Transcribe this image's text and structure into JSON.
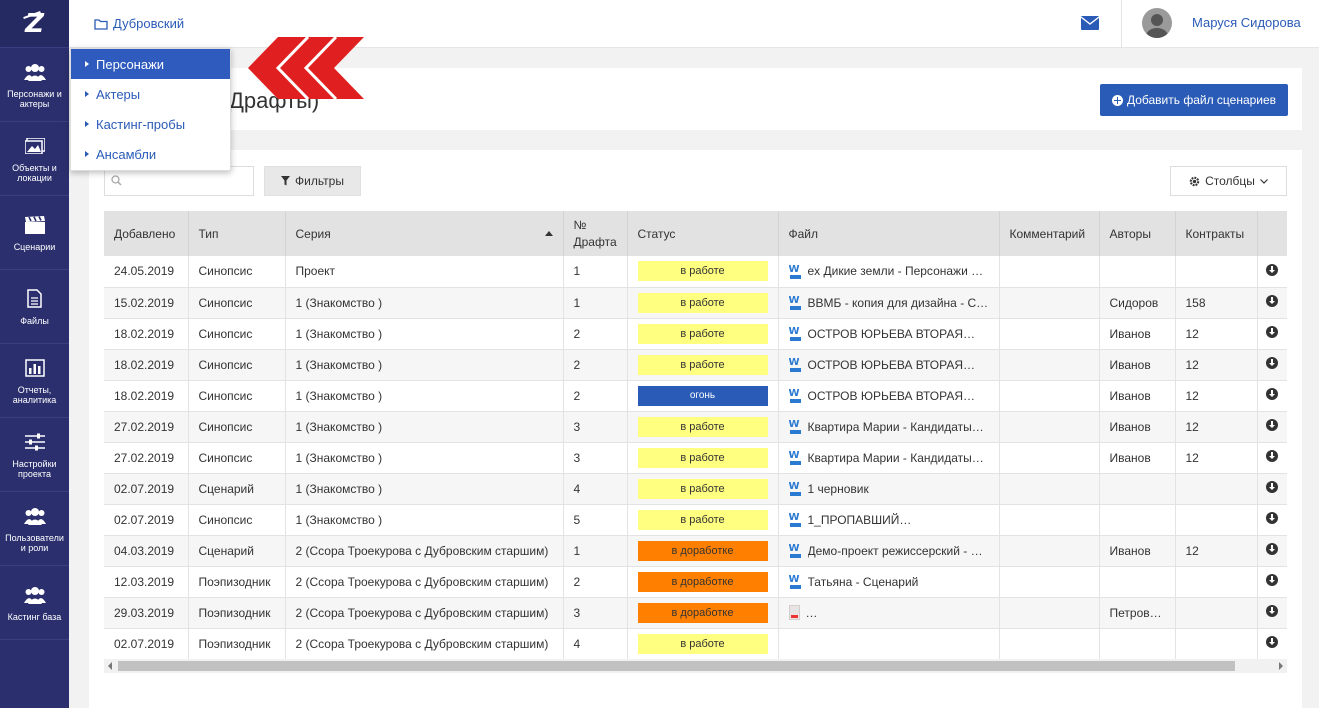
{
  "sidebar": {
    "items": [
      {
        "label": "Персонажи и актеры",
        "icon": "users-icon"
      },
      {
        "label": "Объекты и локации",
        "icon": "image-icon"
      },
      {
        "label": "Сценарии",
        "icon": "clapperboard-icon"
      },
      {
        "label": "Файлы",
        "icon": "file-icon"
      },
      {
        "label": "Отчеты, аналитика",
        "icon": "bar-chart-icon"
      },
      {
        "label": "Настройки проекта",
        "icon": "sliders-icon"
      },
      {
        "label": "Пользователи и роли",
        "icon": "users-icon"
      },
      {
        "label": "Кастинг база",
        "icon": "users-icon"
      }
    ]
  },
  "topbar": {
    "project": "Дубровский",
    "username": "Маруся Сидорова"
  },
  "dropdown": {
    "items": [
      "Персонажи",
      "Актеры",
      "Кастинг-пробы",
      "Ансамбли"
    ]
  },
  "page": {
    "title_visible": "Драфты)",
    "add_button": "Добавить файл сценариев"
  },
  "toolbar": {
    "search_placeholder": "",
    "filters_label": "Фильтры",
    "columns_label": "Столбцы"
  },
  "table": {
    "headers": [
      "Добавлено",
      "Тип",
      "Серия",
      "№ Драфта",
      "Статус",
      "Файл",
      "Комментарий",
      "Авторы",
      "Контракты",
      ""
    ],
    "rows": [
      {
        "date": "24.05.2019",
        "type": "Синопсис",
        "series": "Проект",
        "draft": "1",
        "status": "в работе",
        "status_color": "yellow",
        "file": "ex Дикие земли - Персонажи с…",
        "file_icon": "word",
        "comment": "",
        "authors": "",
        "contracts": ""
      },
      {
        "date": "15.02.2019",
        "type": "Синопсис",
        "series": "1 (Знакомство )",
        "draft": "1",
        "status": "в работе",
        "status_color": "yellow",
        "file": "ВВМБ - копия для дизайна - С…",
        "file_icon": "word",
        "comment": "",
        "authors": "Сидоров",
        "contracts": "158"
      },
      {
        "date": "18.02.2019",
        "type": "Синопсис",
        "series": "1 (Знакомство )",
        "draft": "2",
        "status": "в работе",
        "status_color": "yellow",
        "file": "ОСТРОВ ЮРЬЕВА ВТОРАЯ…",
        "file_icon": "word",
        "comment": "",
        "authors": "Иванов",
        "contracts": "12"
      },
      {
        "date": "18.02.2019",
        "type": "Синопсис",
        "series": "1 (Знакомство )",
        "draft": "2",
        "status": "в работе",
        "status_color": "yellow",
        "file": "ОСТРОВ ЮРЬЕВА ВТОРАЯ…",
        "file_icon": "word",
        "comment": "",
        "authors": "Иванов",
        "contracts": "12"
      },
      {
        "date": "18.02.2019",
        "type": "Синопсис",
        "series": "1 (Знакомство )",
        "draft": "2",
        "status": "огонь",
        "status_color": "blue",
        "file": "ОСТРОВ ЮРЬЕВА ВТОРАЯ…",
        "file_icon": "word",
        "comment": "",
        "authors": "Иванов",
        "contracts": "12"
      },
      {
        "date": "27.02.2019",
        "type": "Синопсис",
        "series": "1 (Знакомство )",
        "draft": "3",
        "status": "в работе",
        "status_color": "yellow",
        "file": "Квартира Марии - Кандидаты…",
        "file_icon": "word",
        "comment": "",
        "authors": "Иванов",
        "contracts": "12"
      },
      {
        "date": "27.02.2019",
        "type": "Синопсис",
        "series": "1 (Знакомство )",
        "draft": "3",
        "status": "в работе",
        "status_color": "yellow",
        "file": "Квартира Марии - Кандидаты…",
        "file_icon": "word",
        "comment": "",
        "authors": "Иванов",
        "contracts": "12"
      },
      {
        "date": "02.07.2019",
        "type": "Сценарий",
        "series": "1 (Знакомство )",
        "draft": "4",
        "status": "в работе",
        "status_color": "yellow",
        "file": "1 черновик",
        "file_icon": "word",
        "comment": "",
        "authors": "",
        "contracts": ""
      },
      {
        "date": "02.07.2019",
        "type": "Синопсис",
        "series": "1 (Знакомство )",
        "draft": "5",
        "status": "в работе",
        "status_color": "yellow",
        "file": "1_ПРОПАВШИЙ…",
        "file_icon": "word",
        "comment": "",
        "authors": "",
        "contracts": ""
      },
      {
        "date": "04.03.2019",
        "type": "Сценарий",
        "series": "2 (Ссора Троекурова с Дубровским старшим)",
        "draft": "1",
        "status": "в доработке",
        "status_color": "orange",
        "file": "Демо-проект режиссерский - …",
        "file_icon": "word",
        "comment": "",
        "authors": "Иванов",
        "contracts": "12"
      },
      {
        "date": "12.03.2019",
        "type": "Поэпизодник",
        "series": "2 (Ссора Троекурова с Дубровским старшим)",
        "draft": "2",
        "status": "в доработке",
        "status_color": "orange",
        "file": "Татьяна - Сценарий",
        "file_icon": "word",
        "comment": "",
        "authors": "",
        "contracts": ""
      },
      {
        "date": "29.03.2019",
        "type": "Поэпизодник",
        "series": "2 (Ссора Троекурова с Дубровским старшим)",
        "draft": "3",
        "status": "в доработке",
        "status_color": "orange",
        "file": "…",
        "file_icon": "pdf",
        "comment": "",
        "authors": "Петров…",
        "contracts": ""
      },
      {
        "date": "02.07.2019",
        "type": "Поэпизодник",
        "series": "2 (Ссора Троекурова с Дубровским старшим)",
        "draft": "4",
        "status": "в работе",
        "status_color": "yellow",
        "file": "",
        "file_icon": "none",
        "comment": "",
        "authors": "",
        "contracts": ""
      }
    ]
  },
  "colors": {
    "sidebar_bg": "#2b2f6e",
    "accent": "#2a5bb7",
    "yellow": "#ffff80",
    "orange": "#ff8000",
    "pointer_red": "#e02020"
  }
}
